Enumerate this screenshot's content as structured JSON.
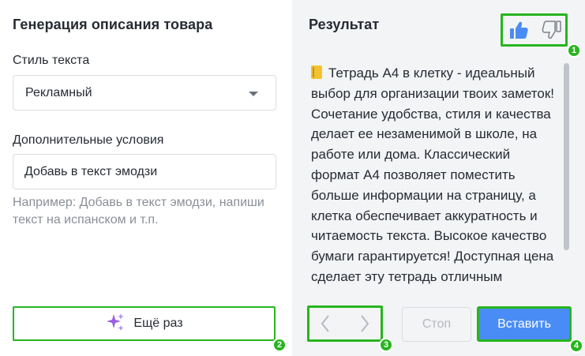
{
  "left_panel": {
    "title": "Генерация описания товара",
    "style_label": "Стиль текста",
    "style_value": "Рекламный",
    "conditions_label": "Дополнительные условия",
    "conditions_value": "Добавь в текст эмодзи",
    "hint": "Например: Добавь в текст эмодзи, напиши текст на испанском и т.п.",
    "again_button": "Ещё раз"
  },
  "right_panel": {
    "title": "Результат",
    "result_text": "Тетрадь А4 в клетку - идеальный выбор для организации твоих заметок! Сочетание удобства, стиля и качества делает ее незаменимой в школе, на работе или дома. Классический формат А4 позволяет поместить больше информации на страницу, а клетка обеспечивает аккуратность и читаемость текста. Высокое качество бумаги гарантируется! Доступная цена сделает эту тетрадь отличным",
    "stop_button": "Стоп",
    "insert_button": "Вставить"
  },
  "badges": {
    "b1": "1",
    "b2": "2",
    "b3": "3",
    "b4": "4"
  },
  "icons": {
    "like": "thumbs-up-icon",
    "dislike": "thumbs-down-icon",
    "sparkles": "sparkles-icon",
    "prev": "chevron-left-icon",
    "next": "chevron-right-icon",
    "emoji": "notebook-emoji"
  },
  "colors": {
    "accent_blue": "#4a8cf5",
    "highlight_green": "#27b51e",
    "sparkle_purple": "#9b5de5"
  }
}
